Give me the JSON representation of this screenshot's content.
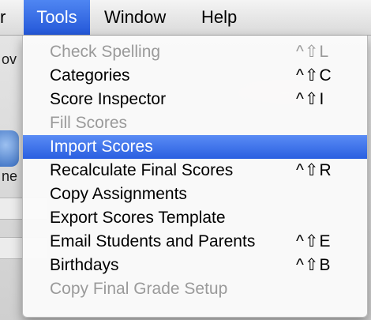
{
  "menubar": {
    "edge_label": "r",
    "items": [
      {
        "label": "Tools"
      },
      {
        "label": "Window"
      },
      {
        "label": "Help"
      }
    ]
  },
  "background": {
    "fragment_1": "ov",
    "fragment_2": "ne"
  },
  "tools_menu": {
    "items": [
      {
        "label": "Check Spelling",
        "shortcut": "^⇧L",
        "enabled": false
      },
      {
        "label": "Categories",
        "shortcut": "^⇧C",
        "enabled": true
      },
      {
        "label": "Score Inspector",
        "shortcut": "^⇧I",
        "enabled": true
      },
      {
        "label": "Fill Scores",
        "shortcut": "",
        "enabled": false
      },
      {
        "label": "Import Scores",
        "shortcut": "",
        "enabled": true,
        "highlighted": true
      },
      {
        "label": "Recalculate Final Scores",
        "shortcut": "^⇧R",
        "enabled": true
      },
      {
        "label": "Copy Assignments",
        "shortcut": "",
        "enabled": true
      },
      {
        "label": "Export Scores Template",
        "shortcut": "",
        "enabled": true
      },
      {
        "label": "Email Students and Parents",
        "shortcut": "^⇧E",
        "enabled": true
      },
      {
        "label": "Birthdays",
        "shortcut": "^⇧B",
        "enabled": true
      },
      {
        "label": "Copy Final Grade Setup",
        "shortcut": "",
        "enabled": false
      }
    ]
  },
  "colors": {
    "highlight": "#2a5fe0",
    "disabled_text": "#9a9a9a"
  }
}
